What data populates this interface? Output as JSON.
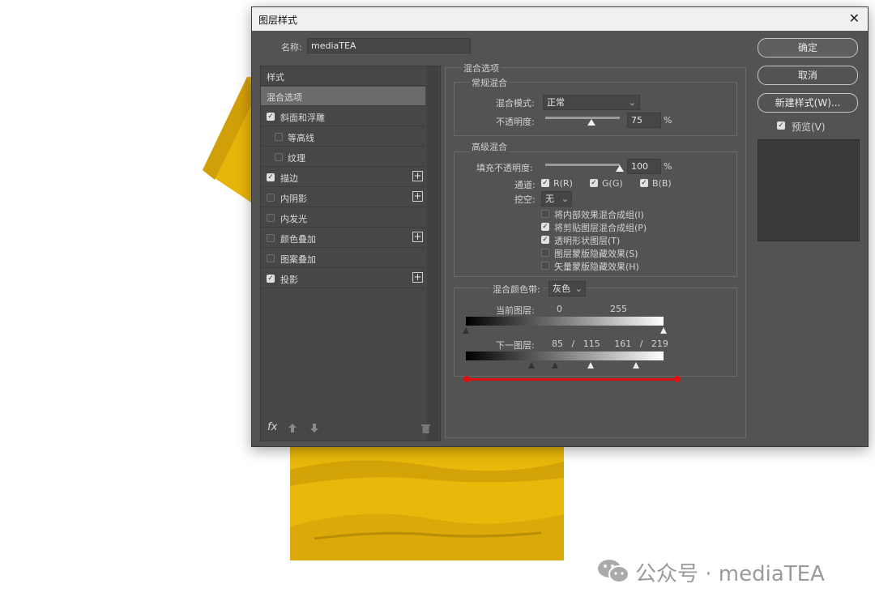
{
  "dialog": {
    "title": "图层样式",
    "close": "✕",
    "name_label": "名称:",
    "name_value": "mediaTEA"
  },
  "buttons": {
    "ok": "确定",
    "cancel": "取消",
    "new_style": "新建样式(W)...",
    "preview": "预览(V)",
    "preview_checked": true
  },
  "styles_list": {
    "header": "样式",
    "items": [
      {
        "label": "混合选项",
        "selected": true,
        "checkbox": null,
        "plus": false,
        "indent": false
      },
      {
        "label": "斜面和浮雕",
        "checkbox": true,
        "plus": false,
        "indent": false
      },
      {
        "label": "等高线",
        "checkbox": false,
        "plus": false,
        "indent": true
      },
      {
        "label": "纹理",
        "checkbox": false,
        "plus": false,
        "indent": true
      },
      {
        "label": "描边",
        "checkbox": true,
        "plus": true,
        "indent": false
      },
      {
        "label": "内阴影",
        "checkbox": false,
        "plus": true,
        "indent": false
      },
      {
        "label": "内发光",
        "checkbox": false,
        "plus": false,
        "indent": false
      },
      {
        "label": "颜色叠加",
        "checkbox": false,
        "plus": true,
        "indent": false
      },
      {
        "label": "图案叠加",
        "checkbox": false,
        "plus": false,
        "indent": false
      },
      {
        "label": "投影",
        "checkbox": true,
        "plus": true,
        "indent": false
      }
    ],
    "fx": "fx"
  },
  "blend": {
    "section_title": "混合选项",
    "general_title": "常规混合",
    "mode_label": "混合模式:",
    "mode_value": "正常",
    "opacity_label": "不透明度:",
    "opacity_value": "75",
    "opacity_fraction": 0.75,
    "percent": "%",
    "advanced_title": "高级混合",
    "fill_label": "填充不透明度:",
    "fill_value": "100",
    "fill_fraction": 1.0,
    "channels_label": "通道:",
    "channel_r": "R(R)",
    "channel_g": "G(G)",
    "channel_b": "B(B)",
    "knockout_label": "挖空:",
    "knockout_value": "无",
    "options": [
      {
        "label": "将内部效果混合成组(I)",
        "checked": false
      },
      {
        "label": "将剪贴图层混合成组(P)",
        "checked": true
      },
      {
        "label": "透明形状图层(T)",
        "checked": true
      },
      {
        "label": "图层蒙版隐藏效果(S)",
        "checked": false
      },
      {
        "label": "矢量蒙版隐藏效果(H)",
        "checked": false
      }
    ],
    "blend_if_label": "混合颜色带:",
    "blend_if_value": "灰色",
    "this_layer_label": "当前图层:",
    "this_layer_low": "0",
    "this_layer_high": "255",
    "underlying_label": "下一图层:",
    "underlying_values": [
      "85",
      "/",
      "115",
      "161",
      "/",
      "219"
    ],
    "underlying_marks": [
      85,
      115,
      161,
      219
    ],
    "this_marks": [
      0,
      255
    ]
  },
  "watermark": {
    "text": "公众号 · mediaTEA"
  },
  "colors": {
    "dialog_bg": "#535353",
    "shirt": "#e9b80a",
    "annotation_red": "#e01010"
  }
}
